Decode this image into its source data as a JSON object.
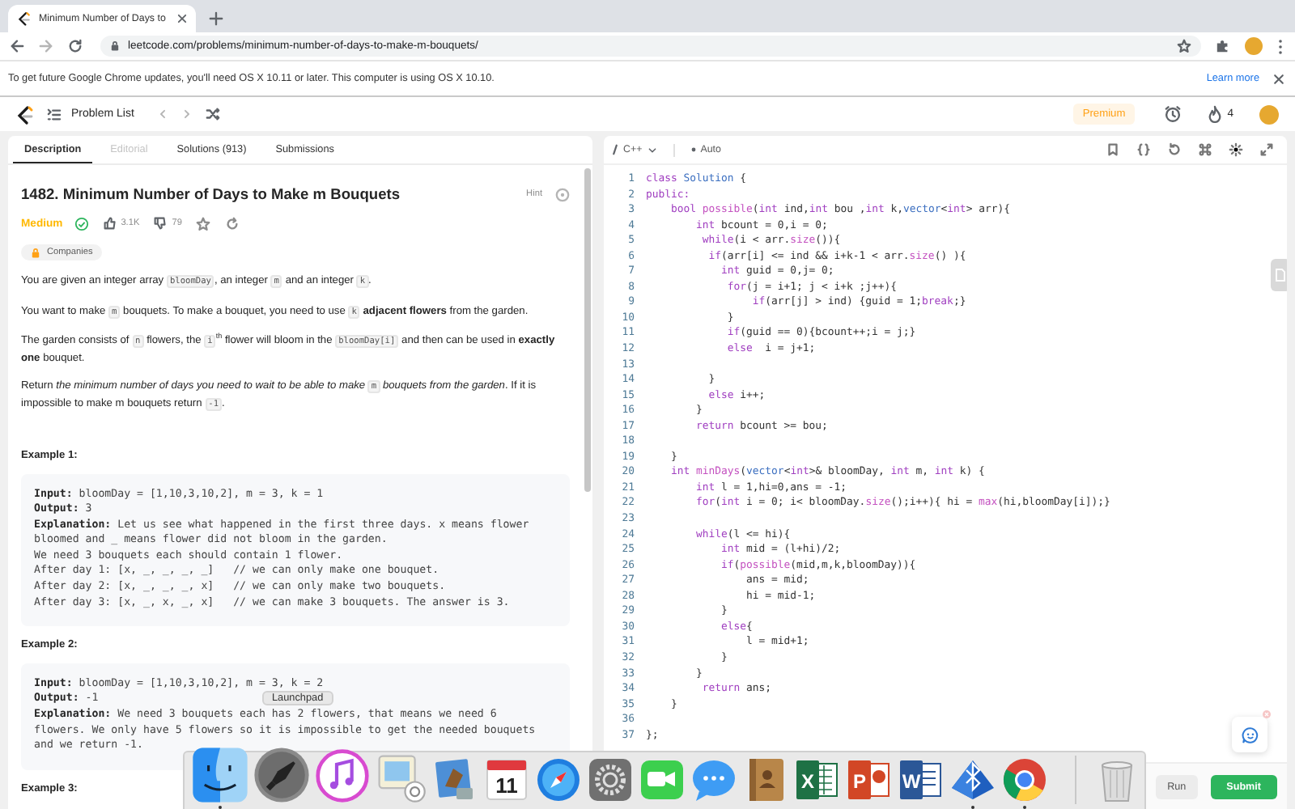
{
  "browser": {
    "tab_title": "Minimum Number of Days to",
    "url": "leetcode.com/problems/minimum-number-of-days-to-make-m-bouquets/"
  },
  "infobar": {
    "message": "To get future Google Chrome updates, you'll need OS X 10.11 or later. This computer is using OS X 10.10.",
    "link": "Learn more"
  },
  "nav": {
    "problem_list": "Problem List",
    "premium": "Premium",
    "streak": "4"
  },
  "description": {
    "tabs": [
      {
        "label": "Description",
        "selected": true,
        "disabled": false
      },
      {
        "label": "Editorial",
        "selected": false,
        "disabled": true
      },
      {
        "label": "Solutions (913)",
        "selected": false,
        "disabled": false
      },
      {
        "label": "Submissions",
        "selected": false,
        "disabled": false
      }
    ],
    "title": "1482. Minimum Number of Days to Make m Bouquets",
    "hint": "Hint",
    "difficulty": "Medium",
    "solved": true,
    "likes": "3.1K",
    "dislikes": "79",
    "companies": "Companies",
    "paragraphs": [
      [
        {
          "text": "You are given an integer array "
        },
        {
          "kind": "code",
          "text": "bloomDay"
        },
        {
          "text": ", an integer "
        },
        {
          "kind": "code",
          "text": "m"
        },
        {
          "text": " and an integer "
        },
        {
          "kind": "code",
          "text": "k"
        },
        {
          "text": "."
        }
      ],
      [
        {
          "text": "You want to make "
        },
        {
          "kind": "code",
          "text": "m"
        },
        {
          "text": " bouquets. To make a bouquet, you need to use "
        },
        {
          "kind": "code",
          "text": "k"
        },
        {
          "kind": "bold",
          "text": " adjacent flowers"
        },
        {
          "text": " from the garden."
        }
      ],
      [
        {
          "text": "The garden consists of "
        },
        {
          "kind": "code",
          "text": "n"
        },
        {
          "text": " flowers, the "
        },
        {
          "kind": "code",
          "text": "i"
        },
        {
          "kind": "sup",
          "text": "th"
        },
        {
          "text": " flower will bloom in the "
        },
        {
          "kind": "code",
          "text": "bloomDay[i]"
        },
        {
          "text": " and then can be used in "
        },
        {
          "kind": "bold",
          "text": "exactly one"
        },
        {
          "text": " bouquet."
        }
      ],
      [
        {
          "text": "Return "
        },
        {
          "kind": "italic",
          "text": "the minimum number of days you need to wait to be able to make "
        },
        {
          "kind": "code",
          "text": "m"
        },
        {
          "kind": "italic",
          "text": " bouquets from the garden"
        },
        {
          "text": ". If it is impossible to make m bouquets return "
        },
        {
          "kind": "code",
          "text": "-1"
        },
        {
          "text": "."
        }
      ]
    ],
    "examples": [
      {
        "heading": "Example 1:",
        "lines": [
          [
            {
              "kind": "bold",
              "text": "Input:"
            },
            {
              "text": " bloomDay = [1,10,3,10,2], m = 3, k = 1"
            }
          ],
          [
            {
              "kind": "bold",
              "text": "Output:"
            },
            {
              "text": " 3"
            }
          ],
          [
            {
              "kind": "bold",
              "text": "Explanation:"
            },
            {
              "text": " Let us see what happened in the first three days. x means flower bloomed and _ means flower did not bloom in the garden."
            }
          ],
          [
            {
              "text": "We need 3 bouquets each should contain 1 flower."
            }
          ],
          [
            {
              "text": "After day 1: [x, _, _, _, _]   // we can only make one bouquet."
            }
          ],
          [
            {
              "text": "After day 2: [x, _, _, _, x]   // we can only make two bouquets."
            }
          ],
          [
            {
              "text": "After day 3: [x, _, x, _, x]   // we can make 3 bouquets. The answer is 3."
            }
          ]
        ]
      },
      {
        "heading": "Example 2:",
        "lines": [
          [
            {
              "kind": "bold",
              "text": "Input:"
            },
            {
              "text": " bloomDay = [1,10,3,10,2], m = 3, k = 2"
            }
          ],
          [
            {
              "kind": "bold",
              "text": "Output:"
            },
            {
              "text": " -1"
            }
          ],
          [
            {
              "kind": "bold",
              "text": "Explanation:"
            },
            {
              "text": " We need 3 bouquets each has 2 flowers, that means we need 6 flowers. We only have 5 flowers so it is impossible to get the needed bouquets and we return -1."
            }
          ]
        ]
      },
      {
        "heading": "Example 3:"
      }
    ]
  },
  "editor": {
    "language": "C++",
    "mode": "Auto",
    "lines": [
      {
        "n": "1",
        "t": [
          {
            "kind": "keyword",
            "text": "class"
          },
          {
            "kind": "type",
            "text": " Solution"
          },
          {
            "text": " {"
          }
        ]
      },
      {
        "n": "2",
        "t": [
          {
            "kind": "keyword",
            "text": "public:"
          }
        ]
      },
      {
        "n": "3",
        "t": [
          {
            "kind": "keyword",
            "text": "    bool"
          },
          {
            "kind": "function",
            "text": " possible"
          },
          {
            "text": "("
          },
          {
            "kind": "keyword",
            "text": "int"
          },
          {
            "text": " ind,"
          },
          {
            "kind": "keyword",
            "text": "int"
          },
          {
            "text": " bou ,"
          },
          {
            "kind": "keyword",
            "text": "int"
          },
          {
            "text": " k,"
          },
          {
            "kind": "type",
            "text": "vector"
          },
          {
            "text": "<"
          },
          {
            "kind": "keyword",
            "text": "int"
          },
          {
            "text": "> arr){"
          }
        ]
      },
      {
        "n": "4",
        "t": [
          {
            "kind": "keyword",
            "text": "        int"
          },
          {
            "text": " bcount = 0,i = 0;"
          }
        ]
      },
      {
        "n": "5",
        "t": [
          {
            "kind": "keyword",
            "text": "         while"
          },
          {
            "text": "(i < arr."
          },
          {
            "kind": "function",
            "text": "size"
          },
          {
            "text": "()){"
          }
        ]
      },
      {
        "n": "6",
        "t": [
          {
            "kind": "keyword",
            "text": "          if"
          },
          {
            "text": "(arr[i] <= ind && i+k-1 < arr."
          },
          {
            "kind": "function",
            "text": "size"
          },
          {
            "text": "() ){"
          }
        ]
      },
      {
        "n": "7",
        "t": [
          {
            "kind": "keyword",
            "text": "            int"
          },
          {
            "text": " guid = 0,j= 0;"
          }
        ]
      },
      {
        "n": "8",
        "t": [
          {
            "kind": "keyword",
            "text": "             for"
          },
          {
            "text": "(j = i+1; j < i+k ;j++){"
          }
        ]
      },
      {
        "n": "9",
        "t": [
          {
            "kind": "keyword",
            "text": "                 if"
          },
          {
            "text": "(arr[j] > ind) {guid = 1;"
          },
          {
            "kind": "keyword",
            "text": "break"
          },
          {
            "text": ";}"
          }
        ]
      },
      {
        "n": "10",
        "t": [
          {
            "text": "             }"
          }
        ]
      },
      {
        "n": "11",
        "t": [
          {
            "kind": "keyword",
            "text": "             if"
          },
          {
            "text": "(guid == 0){bcount++;i = j;}"
          }
        ]
      },
      {
        "n": "12",
        "t": [
          {
            "kind": "keyword",
            "text": "             else"
          },
          {
            "text": "  i = j+1;"
          }
        ]
      },
      {
        "n": "13"
      },
      {
        "n": "14",
        "t": [
          {
            "text": "          }"
          }
        ]
      },
      {
        "n": "15",
        "t": [
          {
            "kind": "keyword",
            "text": "          else"
          },
          {
            "text": " i++;"
          }
        ]
      },
      {
        "n": "16",
        "t": [
          {
            "text": "        }"
          }
        ]
      },
      {
        "n": "17",
        "t": [
          {
            "kind": "keyword",
            "text": "        return"
          },
          {
            "text": " bcount >= bou;"
          }
        ]
      },
      {
        "n": "18"
      },
      {
        "n": "19",
        "t": [
          {
            "text": "    }"
          }
        ]
      },
      {
        "n": "20",
        "t": [
          {
            "kind": "keyword",
            "text": "    int"
          },
          {
            "kind": "function",
            "text": " minDays"
          },
          {
            "text": "("
          },
          {
            "kind": "type",
            "text": "vector"
          },
          {
            "text": "<"
          },
          {
            "kind": "keyword",
            "text": "int"
          },
          {
            "text": ">& bloomDay, "
          },
          {
            "kind": "keyword",
            "text": "int"
          },
          {
            "text": " m, "
          },
          {
            "kind": "keyword",
            "text": "int"
          },
          {
            "text": " k) {"
          }
        ]
      },
      {
        "n": "21",
        "t": [
          {
            "kind": "keyword",
            "text": "        int"
          },
          {
            "text": " l = 1,hi=0,ans = -1;"
          }
        ]
      },
      {
        "n": "22",
        "t": [
          {
            "kind": "keyword",
            "text": "        for"
          },
          {
            "text": "("
          },
          {
            "kind": "keyword",
            "text": "int"
          },
          {
            "text": " i = 0; i< bloomDay."
          },
          {
            "kind": "function",
            "text": "size"
          },
          {
            "text": "();i++){ hi = "
          },
          {
            "kind": "function",
            "text": "max"
          },
          {
            "text": "(hi,bloomDay[i]);}"
          }
        ]
      },
      {
        "n": "23"
      },
      {
        "n": "24",
        "t": [
          {
            "kind": "keyword",
            "text": "        while"
          },
          {
            "text": "(l <= hi){"
          }
        ]
      },
      {
        "n": "25",
        "t": [
          {
            "kind": "keyword",
            "text": "            int"
          },
          {
            "text": " mid = (l+hi)/2;"
          }
        ]
      },
      {
        "n": "26",
        "t": [
          {
            "kind": "keyword",
            "text": "            if"
          },
          {
            "text": "("
          },
          {
            "kind": "function",
            "text": "possible"
          },
          {
            "text": "(mid,m,k,bloomDay)){"
          }
        ]
      },
      {
        "n": "27",
        "t": [
          {
            "text": "                ans = mid;"
          }
        ]
      },
      {
        "n": "28",
        "t": [
          {
            "text": "                hi = mid-1;"
          }
        ]
      },
      {
        "n": "29",
        "t": [
          {
            "text": "            }"
          }
        ]
      },
      {
        "n": "30",
        "t": [
          {
            "kind": "keyword",
            "text": "            else"
          },
          {
            "text": "{"
          }
        ]
      },
      {
        "n": "31",
        "t": [
          {
            "text": "                l = mid+1;"
          }
        ]
      },
      {
        "n": "32",
        "t": [
          {
            "text": "            }"
          }
        ]
      },
      {
        "n": "33",
        "t": [
          {
            "text": "        }"
          }
        ]
      },
      {
        "n": "34",
        "t": [
          {
            "kind": "keyword",
            "text": "         return"
          },
          {
            "text": " ans;"
          }
        ]
      },
      {
        "n": "35",
        "t": [
          {
            "text": "    }"
          }
        ]
      },
      {
        "n": "36"
      },
      {
        "n": "37",
        "t": [
          {
            "text": "};"
          }
        ]
      }
    ]
  },
  "actions": {
    "run": "Run",
    "submit": "Submit"
  },
  "dock": {
    "tooltip": "Launchpad",
    "items": [
      {
        "kind": "finder",
        "running": true
      },
      {
        "kind": "launchpad",
        "running": false
      },
      {
        "kind": "music",
        "running": false
      },
      {
        "kind": "photos",
        "running": false
      },
      {
        "kind": "bird",
        "running": false
      },
      {
        "kind": "calendar",
        "text": "11",
        "running": false
      },
      {
        "kind": "compass",
        "running": false
      },
      {
        "kind": "gear",
        "running": false
      },
      {
        "kind": "video",
        "running": false
      },
      {
        "kind": "chat",
        "running": false
      },
      {
        "kind": "book",
        "running": false
      },
      {
        "kind": "sheet",
        "text": "X",
        "running": false
      },
      {
        "kind": "slides",
        "text": "P",
        "running": false
      },
      {
        "kind": "doc",
        "text": "W",
        "running": false
      },
      {
        "kind": "pyramid",
        "running": true
      },
      {
        "kind": "chrome",
        "running": true
      },
      {
        "kind": "trash",
        "running": false
      }
    ]
  }
}
